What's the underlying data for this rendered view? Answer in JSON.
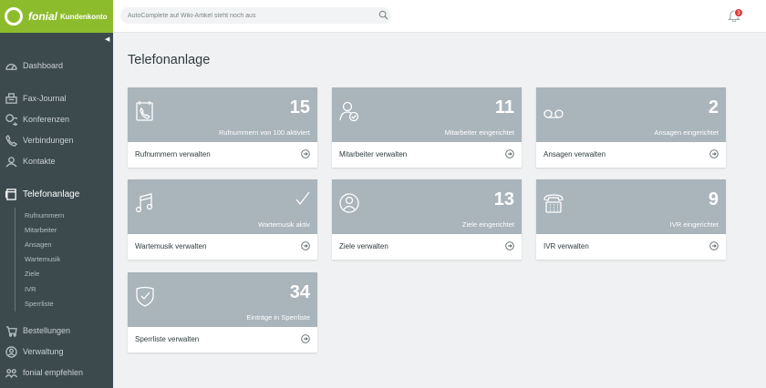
{
  "app": {
    "brand": "fonial",
    "brand_sub": "Kundenkonto"
  },
  "search": {
    "placeholder": "AutoComplete auf Wiki-Artikel steht noch aus"
  },
  "notifications": {
    "count": "3"
  },
  "sidebar": {
    "items": [
      {
        "label": "Dashboard",
        "icon": "dashboard-gauge-icon"
      },
      {
        "label": "Fax-Journal",
        "icon": "fax-icon"
      },
      {
        "label": "Konferenzen",
        "icon": "chat-bubbles-icon"
      },
      {
        "label": "Verbindungen",
        "icon": "phone-icon"
      },
      {
        "label": "Kontakte",
        "icon": "contacts-icon"
      },
      {
        "label": "Telefonanlage",
        "icon": "pbx-icon"
      },
      {
        "label": "Bestellungen",
        "icon": "cart-icon"
      },
      {
        "label": "Verwaltung",
        "icon": "user-circle-icon"
      },
      {
        "label": "fonial empfehlen",
        "icon": "people-icon"
      }
    ],
    "subitems": [
      "Rufnummern",
      "Mitarbeiter",
      "Ansagen",
      "Wartemusik",
      "Ziele",
      "IVR",
      "Sperrliste"
    ]
  },
  "main": {
    "title": "Telefonanlage",
    "cards": [
      {
        "number": "15",
        "desc": "Rufnummern von 100 aktiviert",
        "link": "Rufnummern verwalten",
        "icon": "phonebook-icon"
      },
      {
        "number": "11",
        "desc": "Mitarbeiter eingerichtet",
        "link": "Mitarbeiter verwalten",
        "icon": "user-check-icon"
      },
      {
        "number": "2",
        "desc": "Ansagen eingerichtet",
        "link": "Ansagen verwalten",
        "icon": "voicemail-icon"
      },
      {
        "number": "",
        "desc": "Wartemusik aktiv",
        "link": "Wartemusik verwalten",
        "icon": "music-note-icon"
      },
      {
        "number": "13",
        "desc": "Ziele eingerichtet",
        "link": "Ziele verwalten",
        "icon": "user-circle-icon"
      },
      {
        "number": "9",
        "desc": "IVR eingerichtet",
        "link": "IVR verwalten",
        "icon": "desk-phone-icon"
      },
      {
        "number": "34",
        "desc": "Einträge in Sperrliste",
        "link": "Sperrliste verwalten",
        "icon": "shield-check-icon"
      }
    ]
  },
  "colors": {
    "brand_green": "#8cbc2b",
    "sidebar": "#3c4a4e",
    "card_top": "#a9b4bb",
    "badge_red": "#e03232"
  }
}
